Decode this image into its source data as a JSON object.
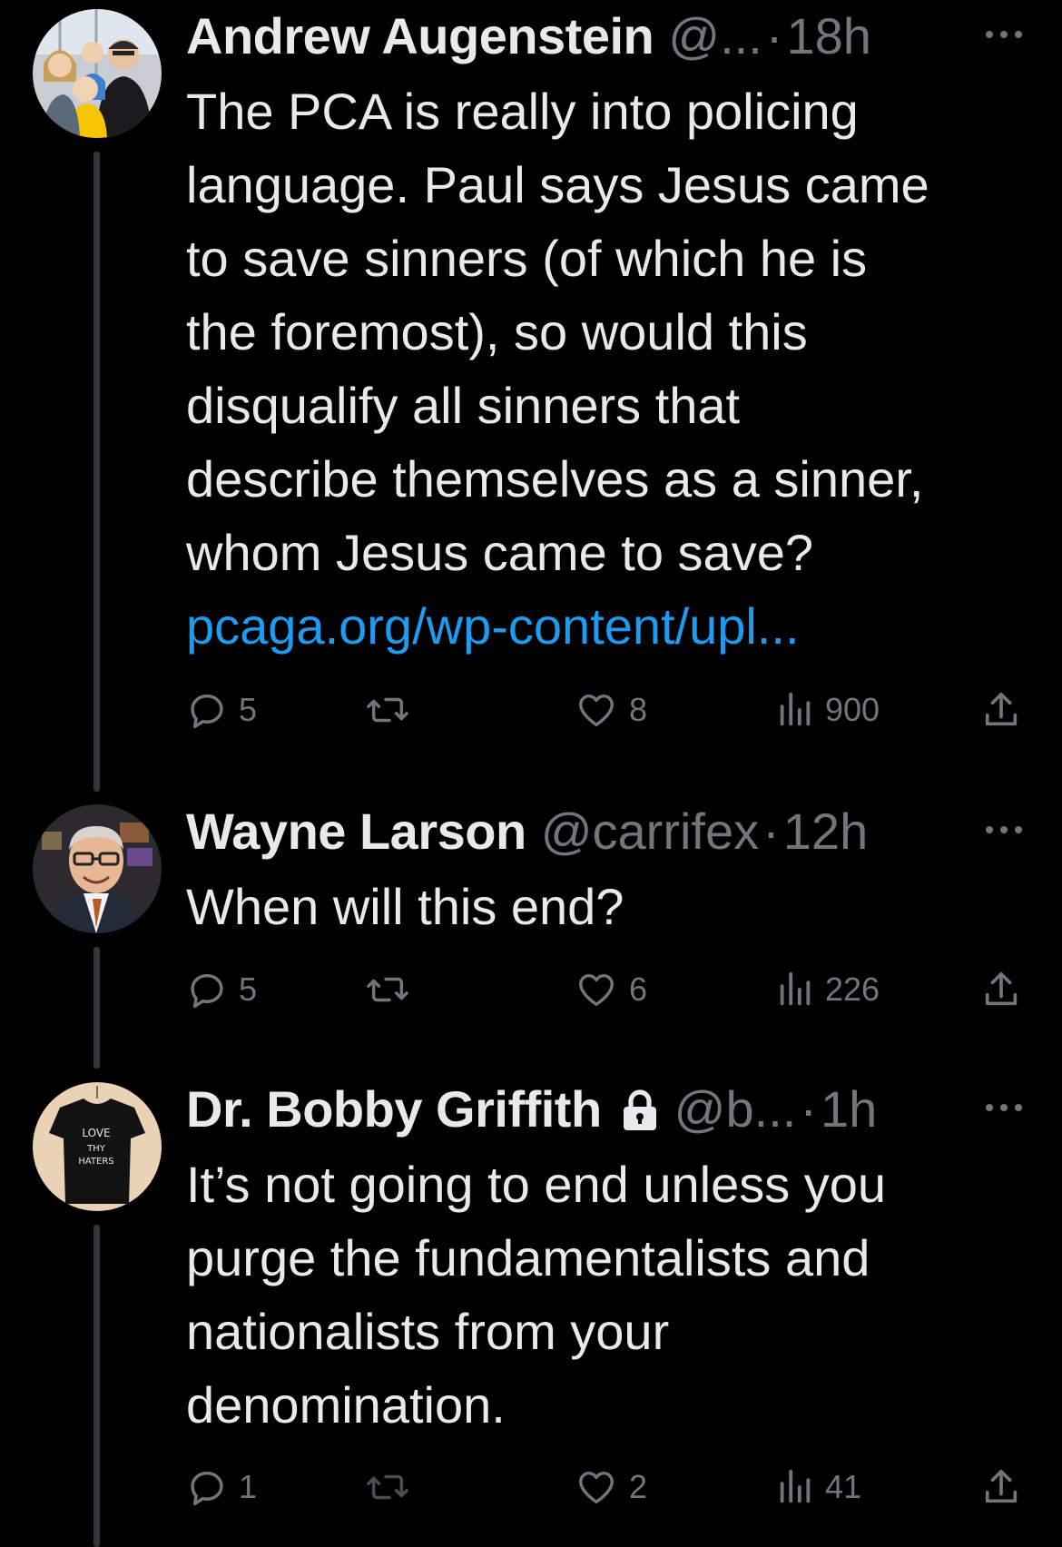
{
  "colors": {
    "background": "#000000",
    "text_primary": "#e7e9ea",
    "text_secondary": "#71767b",
    "link": "#1d9bf0",
    "thread_line": "#333639"
  },
  "tweets": [
    {
      "name": "Andrew Augenstein",
      "handle": "@...",
      "separator": "·",
      "time": "18h",
      "protected": false,
      "text_lines": [
        "The PCA is really into policing",
        "language. Paul says Jesus came",
        "to save sinners (of which he is",
        "the foremost), so would this",
        "disqualify all sinners that",
        "describe themselves as a sinner,",
        "whom Jesus came to save?"
      ],
      "link": "pcaga.org/wp-content/upl...",
      "replies": "5",
      "retweets": "",
      "likes": "8",
      "views": "900",
      "avatar_icon": "family-photo-avatar"
    },
    {
      "name": "Wayne Larson",
      "handle": "@carrifex",
      "separator": "·",
      "time": "12h",
      "protected": false,
      "text_lines": [
        "When will this end?"
      ],
      "replies": "5",
      "retweets": "",
      "likes": "6",
      "views": "226",
      "avatar_icon": "man-portrait-avatar"
    },
    {
      "name": "Dr. Bobby Griffith",
      "handle": "@b...",
      "separator": "·",
      "time": "1h",
      "protected": true,
      "text_lines": [
        "It’s not going to end unless you",
        "purge the fundamentalists and",
        "nationalists from your",
        "denomination."
      ],
      "replies": "1",
      "retweets": "",
      "likes": "2",
      "views": "41",
      "avatar_icon": "tshirt-avatar",
      "avatar_text": [
        "LOVE",
        "THY",
        "HATERS"
      ]
    }
  ]
}
